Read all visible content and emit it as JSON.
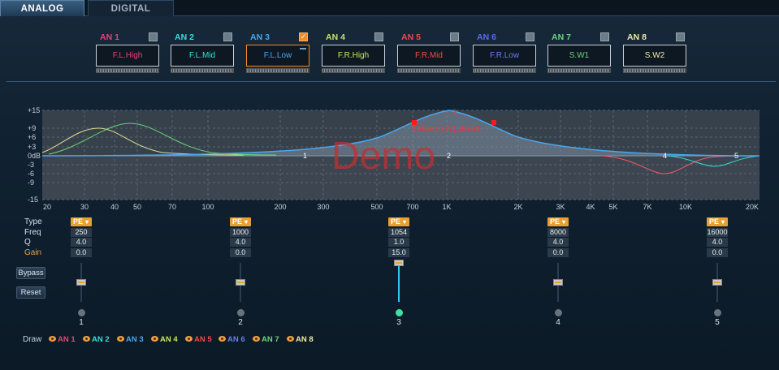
{
  "tabs": [
    {
      "label": "ANALOG",
      "active": true
    },
    {
      "label": "DIGITAL",
      "active": false
    }
  ],
  "channels": [
    {
      "id": "AN 1",
      "name": "F.L.High",
      "color": "#e8407a",
      "checked": false
    },
    {
      "id": "AN 2",
      "name": "F.L.Mid",
      "color": "#2ee0d8",
      "checked": false
    },
    {
      "id": "AN 3",
      "name": "F.L.Low",
      "color": "#4aa6ee",
      "checked": true
    },
    {
      "id": "AN 4",
      "name": "F.R.High",
      "color": "#c8e65a",
      "checked": false
    },
    {
      "id": "AN 5",
      "name": "F.R.Mid",
      "color": "#f04a4a",
      "checked": false
    },
    {
      "id": "AN 6",
      "name": "F.R.Low",
      "color": "#5a6cf0",
      "checked": false
    },
    {
      "id": "AN 7",
      "name": "S.W1",
      "color": "#6ad47a",
      "checked": false
    },
    {
      "id": "AN 8",
      "name": "S.W2",
      "color": "#f0e8a8",
      "checked": false
    }
  ],
  "graph": {
    "y_ticks": [
      "+15",
      "+9",
      "+6",
      "+3",
      "0dB",
      "-3",
      "-6",
      "-9",
      "-15"
    ],
    "x_ticks": [
      "20",
      "30",
      "40",
      "50",
      "70",
      "100",
      "200",
      "300",
      "500",
      "700",
      "1K",
      "2K",
      "3K",
      "4K",
      "5K",
      "7K",
      "10K",
      "20K"
    ],
    "watermark": "Demo",
    "readout": "1054Hz  1.0Q  15.0dB",
    "active_marker": "3",
    "point_labels": [
      "1",
      "2",
      "4",
      "5"
    ]
  },
  "params": {
    "labels": {
      "type": "Type",
      "freq": "Freq",
      "q": "Q",
      "gain": "Gain"
    },
    "bands": [
      {
        "num": "1",
        "type": "PE",
        "freq": "250",
        "q": "4.0",
        "gain": "0.0",
        "active": false
      },
      {
        "num": "2",
        "type": "PE",
        "freq": "1000",
        "q": "4.0",
        "gain": "0.0",
        "active": false
      },
      {
        "num": "3",
        "type": "PE",
        "freq": "1054",
        "q": "1.0",
        "gain": "15.0",
        "active": true
      },
      {
        "num": "4",
        "type": "PE",
        "freq": "8000",
        "q": "4.0",
        "gain": "0.0",
        "active": false
      },
      {
        "num": "5",
        "type": "PE",
        "freq": "16000",
        "q": "4.0",
        "gain": "0.0",
        "active": false
      }
    ]
  },
  "buttons": {
    "bypass": "Bypass",
    "reset": "Reset"
  },
  "draw": {
    "label": "Draw",
    "items": [
      "AN 1",
      "AN 2",
      "AN 3",
      "AN 4",
      "AN 5",
      "AN 6",
      "AN 7",
      "AN 8"
    ]
  }
}
